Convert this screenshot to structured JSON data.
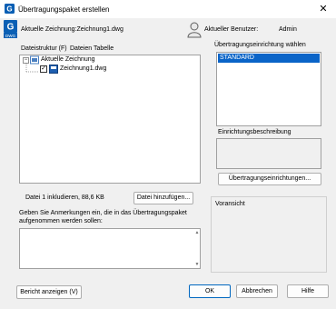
{
  "window": {
    "title": "Übertragungspaket erstellen",
    "close_label": "✕"
  },
  "header": {
    "current_drawing": "Aktuelle Zeichnung:Zeichnung1.dwg",
    "current_user_label": "Aktueller Benutzer:",
    "current_user_value": "Admin"
  },
  "tabs": [
    {
      "label": "Dateistruktur (F)"
    },
    {
      "label": "Dateien Tabelle"
    }
  ],
  "tree": {
    "root_label": "Aktuelle Zeichnung",
    "child_label": "Zeichnung1.dwg",
    "collapse_glyph": "−",
    "check_glyph": "✓"
  },
  "file_info": "Datei 1 inkludieren, 88,6 KB",
  "buttons": {
    "add_file": "Datei hinzufügen...",
    "transfer_setups": "Übertragungseinrichtungen...",
    "show_report": "Bericht anzeigen (V)",
    "ok": "OK",
    "cancel": "Abbrechen",
    "help": "Hilfe"
  },
  "transfer_setup": {
    "label": "Übertragungseinrichtung wählen",
    "items": [
      "STANDARD"
    ],
    "selected": "STANDARD"
  },
  "setup_description_label": "Einrichtungsbeschreibung",
  "notes": {
    "label_line1": "Geben Sie Anmerkungen ein, die in das Übertragungspaket",
    "label_line2": "aufgenommen werden sollen:",
    "value": ""
  },
  "preview_label": "Voransicht",
  "colors": {
    "accent": "#0067c0",
    "selection": "#0a64c8"
  }
}
